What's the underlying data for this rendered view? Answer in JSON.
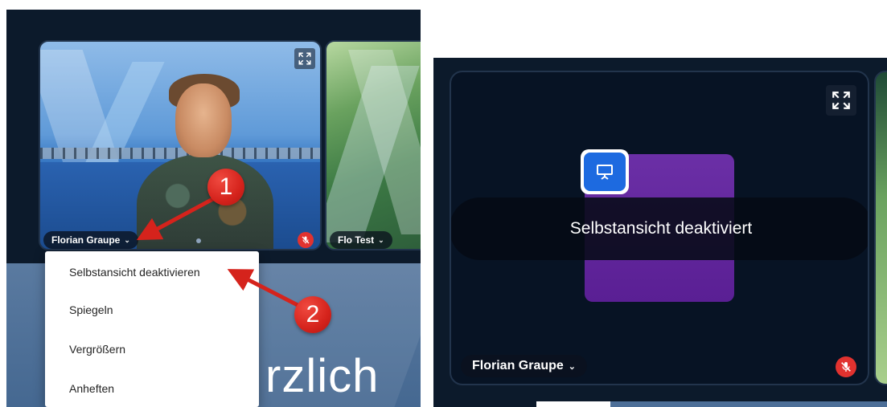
{
  "left": {
    "main_tile": {
      "participant_name": "Florian Graupe",
      "chevron": "⌄"
    },
    "second_tile": {
      "participant_name": "Flo Test",
      "chevron": "⌄"
    },
    "context_menu": {
      "items": [
        {
          "label": "Selbstansicht deaktivieren"
        },
        {
          "label": "Spiegeln"
        },
        {
          "label": "Vergrößern"
        },
        {
          "label": "Anheften"
        }
      ]
    },
    "markers": {
      "one": "1",
      "two": "2"
    },
    "slide_text": "rzlich"
  },
  "right": {
    "toast_message": "Selbstansicht deaktiviert",
    "participant_name": "Florian Graupe",
    "chevron": "⌄"
  },
  "icons": {
    "expand": "expand-icon",
    "mic_muted": "mic-muted-icon",
    "presentation": "presentation-icon"
  },
  "colors": {
    "background": "#0c1a2b",
    "accent_red": "#e1322f",
    "presentation_blue": "#1d6ae0",
    "card_purple": "#5a1f94"
  }
}
